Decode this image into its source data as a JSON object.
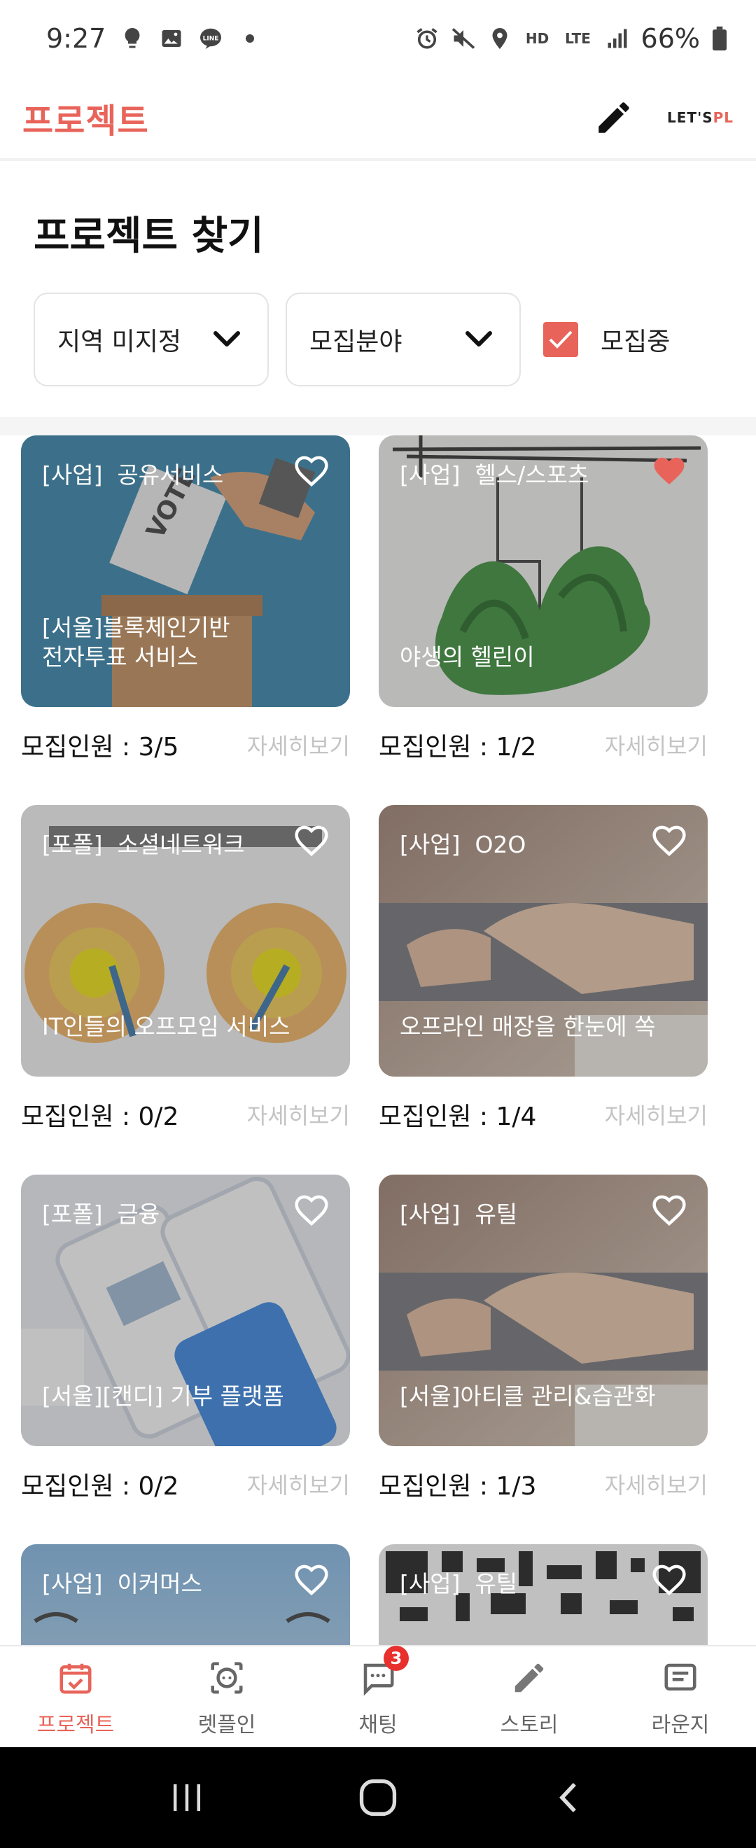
{
  "status_bar": {
    "time": "9:27",
    "left_icons": [
      "lightbulb-icon",
      "image-icon",
      "line-app-icon",
      "dot-icon"
    ],
    "line_label": "LINE",
    "right_icons": [
      "alarm-icon",
      "mute-icon",
      "location-icon",
      "hd-voice-icon",
      "lte-icon",
      "signal-icon",
      "battery-icon"
    ],
    "hd_label": "HD",
    "lte_label": "LTE",
    "battery": "66%"
  },
  "header": {
    "title": "프로젝트",
    "edit_icon": "pencil-icon",
    "brand_a": "LET'S",
    "brand_b": "PL"
  },
  "page": {
    "heading": "프로젝트 찾기"
  },
  "filters": {
    "region": "지역 미지정",
    "field": "모집분야",
    "recruiting_label": "모집중",
    "recruiting_checked": true
  },
  "colors": {
    "accent": "#e8645a",
    "heart_active": "#e8645a",
    "muted_text": "#c4c4c4",
    "badge": "#e8312c"
  },
  "cards": [
    {
      "category": "[사업]  공유서비스",
      "title": "[서울]블록체인기반\n전자투표 서비스",
      "members": "모집인원 : 3/5",
      "detail": "자세히보기",
      "liked": false,
      "image": "vote-ballot"
    },
    {
      "category": "[사업]  헬스/스포츠",
      "title": "야생의 헬린이",
      "members": "모집인원 : 1/2",
      "detail": "자세히보기",
      "liked": true,
      "image": "doodle-sketch"
    },
    {
      "category": "[포폴]  소셜네트워크",
      "title": "IT인들의 오프모임 서비스",
      "members": "모집인원 : 0/2",
      "detail": "자세히보기",
      "liked": false,
      "image": "golden-circle"
    },
    {
      "category": "[사업]  O2O",
      "title": "오프라인 매장을 한눈에 쏙",
      "members": "모집인원 : 1/4",
      "detail": "자세히보기",
      "liked": false,
      "image": "laptop-typing"
    },
    {
      "category": "[포폴]  금융",
      "title": "[서울][캔디] 기부 플랫폼",
      "members": "모집인원 : 0/2",
      "detail": "자세히보기",
      "liked": false,
      "image": "phone-mockups"
    },
    {
      "category": "[사업]  유틸",
      "title": "[서울]아티클 관리&습관화",
      "members": "모집인원 : 1/3",
      "detail": "자세히보기",
      "liked": false,
      "image": "laptop-typing"
    },
    {
      "category": "[사업]  이커머스",
      "title": "",
      "members": "",
      "detail": "",
      "liked": false,
      "image": "sky-parachute"
    },
    {
      "category": "[사업]  유틸",
      "title": "",
      "members": "",
      "detail": "",
      "liked": false,
      "image": "qr-pattern"
    }
  ],
  "bottom_nav": [
    {
      "label": "프로젝트",
      "icon": "calendar-check-icon",
      "active": true
    },
    {
      "label": "렛플인",
      "icon": "face-scan-icon",
      "active": false
    },
    {
      "label": "채팅",
      "icon": "chat-bubble-icon",
      "active": false,
      "badge": "3"
    },
    {
      "label": "스토리",
      "icon": "pencil-icon",
      "active": false
    },
    {
      "label": "라운지",
      "icon": "message-box-icon",
      "active": false
    }
  ],
  "system_nav": [
    "recents-icon",
    "home-icon",
    "back-icon"
  ]
}
